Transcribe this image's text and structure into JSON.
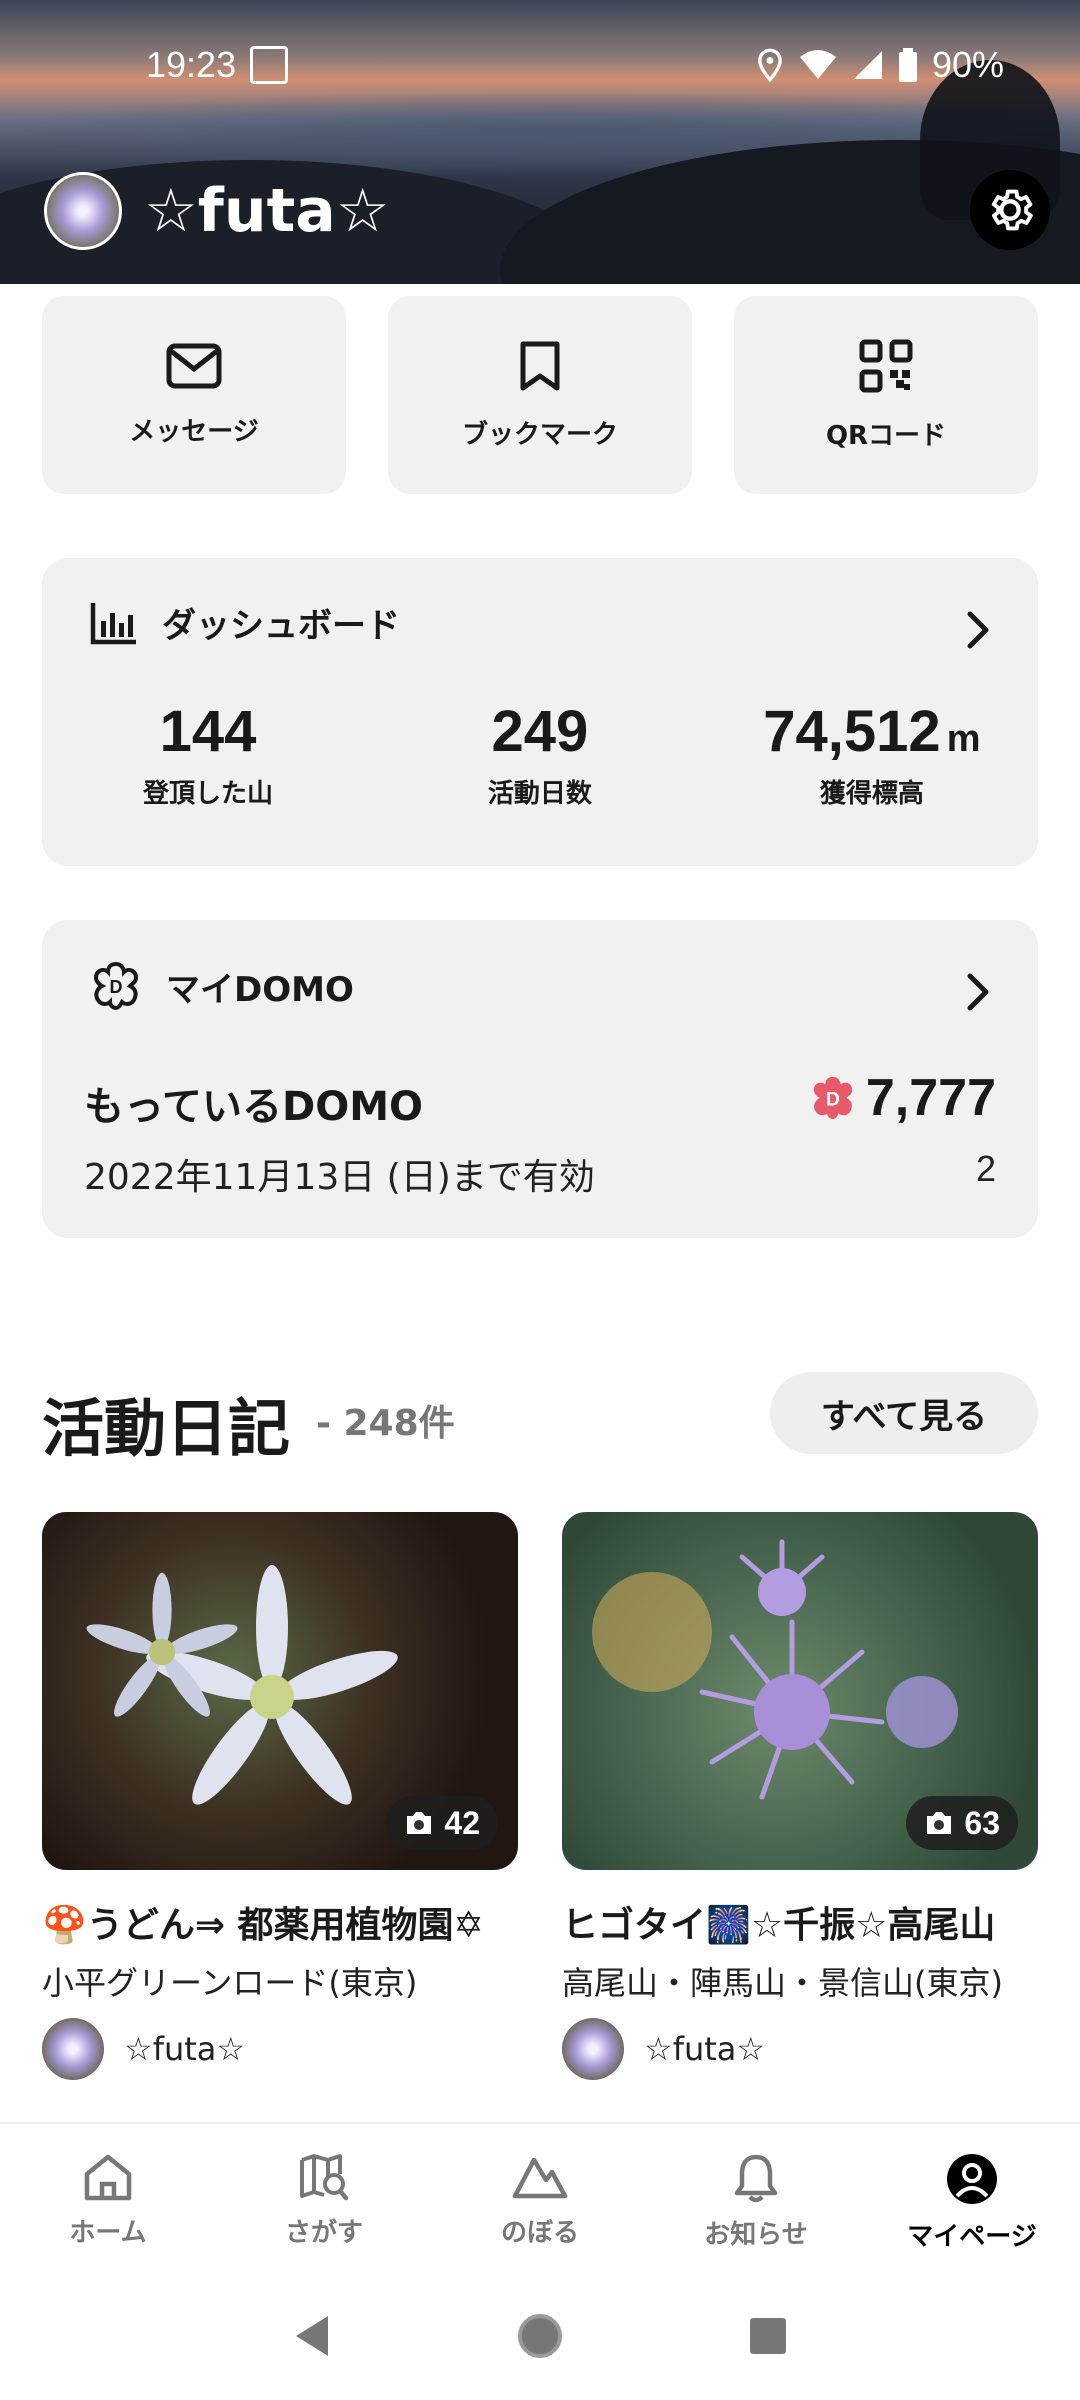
{
  "status_bar": {
    "time": "19:23",
    "battery": "90%"
  },
  "profile": {
    "username": "☆futa☆"
  },
  "quick_actions": [
    {
      "label": "メッセージ",
      "icon": "mail-icon"
    },
    {
      "label": "ブックマーク",
      "icon": "bookmark-icon"
    },
    {
      "label": "QRコード",
      "icon": "qr-code-icon"
    }
  ],
  "dashboard": {
    "title": "ダッシュボード",
    "stats": [
      {
        "value": "144",
        "unit": "",
        "label": "登頂した山"
      },
      {
        "value": "249",
        "unit": "",
        "label": "活動日数"
      },
      {
        "value": "74,512",
        "unit": "m",
        "label": "獲得標高"
      }
    ]
  },
  "domo": {
    "title": "マイDOMO",
    "have_label": "もっているDOMO",
    "amount": "7,777",
    "valid_until": "2022年11月13日 (日)まで有効",
    "count": "2"
  },
  "diary": {
    "title": "活動日記",
    "count": "- 248件",
    "see_all": "すべて見る",
    "items": [
      {
        "photos": "42",
        "title": "🍄うどん⇒ 都薬用植物園✡",
        "location": "小平グリーンロード(東京)",
        "user": "☆futa☆"
      },
      {
        "photos": "63",
        "title": "ヒゴタイ🎆☆千振☆高尾山",
        "location": "高尾山・陣馬山・景信山(東京)",
        "user": "☆futa☆"
      }
    ]
  },
  "bottom_nav": [
    {
      "label": "ホーム",
      "icon": "home-icon",
      "active": false
    },
    {
      "label": "さがす",
      "icon": "map-search-icon",
      "active": false
    },
    {
      "label": "のぼる",
      "icon": "mountain-icon",
      "active": false
    },
    {
      "label": "お知らせ",
      "icon": "bell-icon",
      "active": false
    },
    {
      "label": "マイページ",
      "icon": "user-icon",
      "active": true
    }
  ],
  "colors": {
    "accent_domo": "#e85a6a",
    "card_bg": "#f1f1f1"
  }
}
